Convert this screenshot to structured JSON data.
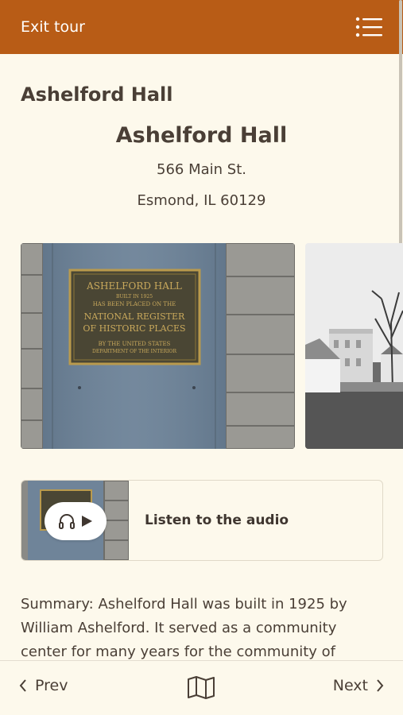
{
  "header": {
    "exit_label": "Exit tour",
    "menu_icon": "list-menu-icon",
    "background": "#b85c16"
  },
  "site": {
    "title": "Ashelford Hall",
    "name": "Ashelford Hall",
    "address_line1": "566 Main St.",
    "address_line2": "Esmond, IL 60129"
  },
  "gallery": {
    "photo1": {
      "plaque_title": "ASHELFORD HALL",
      "plaque_line1": "BUILT IN 1925",
      "plaque_line2": "HAS BEEN PLACED ON THE",
      "plaque_line3": "NATIONAL REGISTER",
      "plaque_line4": "OF HISTORIC PLACES",
      "plaque_line5": "BY THE UNITED STATES",
      "plaque_line6": "DEPARTMENT OF THE INTERIOR"
    },
    "photo2": {}
  },
  "audio": {
    "label": "Listen to the audio",
    "icons": [
      "headphones-icon",
      "play-icon"
    ]
  },
  "summary": {
    "text": "Summary: Ashelford Hall was built in 1925 by William Ashelford. It served as a community center for many years for the community of Esmond. It was"
  },
  "footer": {
    "prev_label": "Prev",
    "next_label": "Next",
    "map_icon": "map-icon"
  }
}
